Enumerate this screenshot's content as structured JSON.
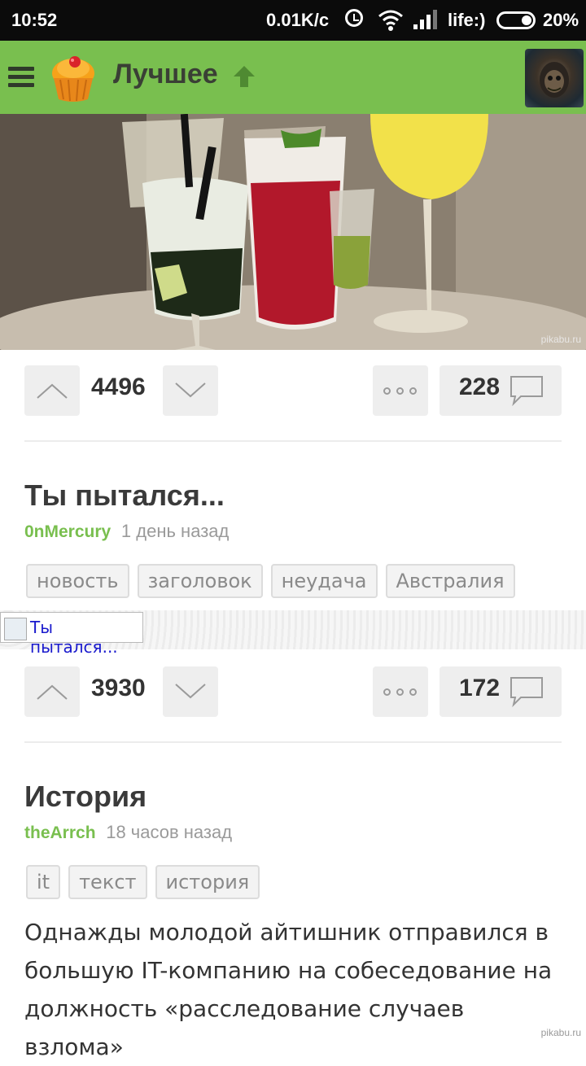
{
  "status_bar": {
    "time": "10:52",
    "net_speed": "0.01K/c",
    "carrier": "life:)",
    "battery": "20%"
  },
  "app_bar": {
    "title": "Лучшее",
    "icons": [
      "menu-icon",
      "cupcake-logo-icon",
      "arrow-up-icon",
      "user-avatar"
    ]
  },
  "posts": [
    {
      "image_watermark": "pikabu.ru",
      "rating": "4496",
      "comments": "228"
    },
    {
      "title": "Ты пытался...",
      "author": "0nMercury",
      "time": "1 день назад",
      "tags": [
        "новость",
        "заголовок",
        "неудача",
        "Австралия"
      ],
      "image_alt": "Ты пытался...",
      "rating": "3930",
      "comments": "172"
    },
    {
      "title": "История",
      "author": "theArrch",
      "time": "18 часов назад",
      "tags": [
        "it",
        "текст",
        "история"
      ],
      "body": "Однажды молодой айтишник отправился в большую IT-компанию на собеседование на должность «расследование случаев взлома»"
    }
  ],
  "footer_watermark": "pikabu.ru",
  "colors": {
    "brand_green": "#79bf4f",
    "status_bar": "#0b0b0b",
    "button_bg": "#eeeeee"
  }
}
